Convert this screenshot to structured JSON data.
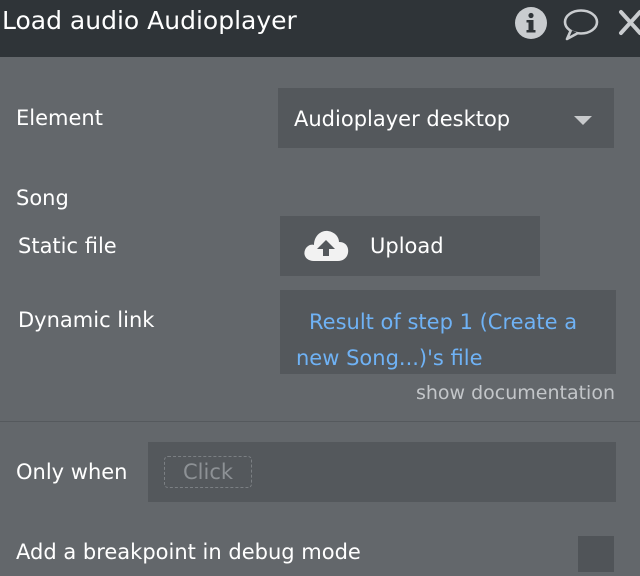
{
  "header": {
    "title": "Load audio Audioplayer",
    "icons": [
      "info-icon",
      "comment-icon",
      "close-icon"
    ]
  },
  "fields": {
    "element_label": "Element",
    "element_value": "Audioplayer desktop",
    "song_label": "Song",
    "static_file_label": "Static file",
    "upload_label": "Upload",
    "dynamic_link_label": "Dynamic link",
    "dynamic_link_value": "Result of step 1 (Create a new Song...)'s file",
    "show_documentation": "show documentation"
  },
  "conditions": {
    "only_when_label": "Only when",
    "only_when_placeholder": "Click",
    "breakpoint_label": "Add a breakpoint in debug mode",
    "breakpoint_checked": false
  },
  "colors": {
    "panel_bg": "#63676b",
    "header_bg": "#2f3438",
    "field_bg": "#54585c",
    "link_text": "#6fb2f5"
  }
}
